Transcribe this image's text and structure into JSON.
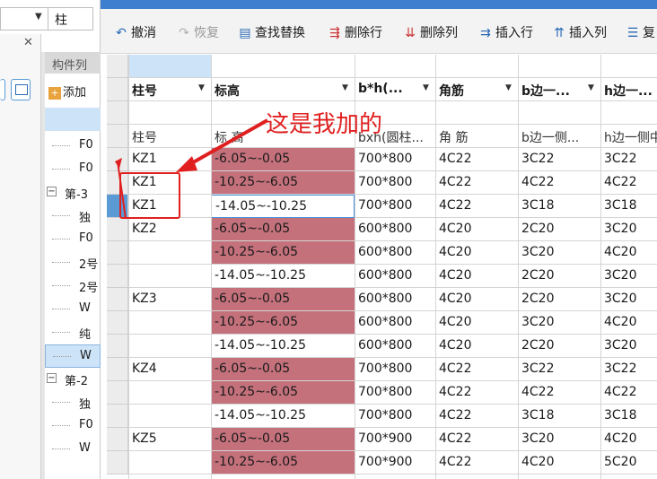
{
  "left_panel": {
    "combo_value": "柱",
    "header": "构件列",
    "add_label": "添加",
    "tree": [
      {
        "type": "item",
        "label": "F0"
      },
      {
        "type": "item",
        "label": "F0"
      },
      {
        "type": "group",
        "label": "第-3"
      },
      {
        "type": "item",
        "label": "独"
      },
      {
        "type": "item",
        "label": "F0"
      },
      {
        "type": "item",
        "label": "2号"
      },
      {
        "type": "item",
        "label": "2号"
      },
      {
        "type": "item",
        "label": "W"
      },
      {
        "type": "item",
        "label": "纯"
      },
      {
        "type": "item",
        "label": "W",
        "selected": true
      },
      {
        "type": "group",
        "label": "第-2"
      },
      {
        "type": "item",
        "label": "独"
      },
      {
        "type": "item",
        "label": "F0"
      },
      {
        "type": "item",
        "label": "W"
      }
    ]
  },
  "toolbar": {
    "undo": "撤消",
    "redo": "恢复",
    "find_replace": "查找替换",
    "delete_row": "删除行",
    "delete_col": "删除列",
    "insert_row": "插入行",
    "insert_col": "插入列",
    "more": "复"
  },
  "table": {
    "headers": [
      "柱号",
      "标高",
      "b*h(...",
      "角筋",
      "b边一...",
      "h边一..."
    ],
    "subheaders": [
      "柱号",
      "标 高",
      "bxh(圆柱...",
      "角 筋",
      "b边一侧...",
      "h边一侧中"
    ],
    "rows": [
      {
        "id": "KZ1",
        "elev": "-6.05~-0.05",
        "bh": "700*800",
        "corner": "4C22",
        "b": "3C22",
        "h": "3C22",
        "pink": true
      },
      {
        "id": "KZ1",
        "elev": "-10.25~-6.05",
        "bh": "700*800",
        "corner": "4C22",
        "b": "4C22",
        "h": "4C22",
        "pink": true
      },
      {
        "id": "KZ1",
        "elev": "-14.05~-10.25",
        "bh": "700*800",
        "corner": "4C22",
        "b": "3C18",
        "h": "3C18",
        "pink": false
      },
      {
        "id": "KZ2",
        "elev": "-6.05~-0.05",
        "bh": "600*800",
        "corner": "4C20",
        "b": "2C20",
        "h": "3C20",
        "pink": true
      },
      {
        "id": "",
        "elev": "-10.25~-6.05",
        "bh": "600*800",
        "corner": "4C20",
        "b": "3C20",
        "h": "4C20",
        "pink": true
      },
      {
        "id": "",
        "elev": "-14.05~-10.25",
        "bh": "600*800",
        "corner": "4C20",
        "b": "2C20",
        "h": "3C20",
        "pink": false
      },
      {
        "id": "KZ3",
        "elev": "-6.05~-0.05",
        "bh": "600*800",
        "corner": "4C20",
        "b": "2C20",
        "h": "3C20",
        "pink": true
      },
      {
        "id": "",
        "elev": "-10.25~-6.05",
        "bh": "600*800",
        "corner": "4C20",
        "b": "3C20",
        "h": "4C20",
        "pink": true
      },
      {
        "id": "",
        "elev": "-14.05~-10.25",
        "bh": "600*800",
        "corner": "4C20",
        "b": "2C20",
        "h": "3C20",
        "pink": false
      },
      {
        "id": "KZ4",
        "elev": "-6.05~-0.05",
        "bh": "700*800",
        "corner": "4C22",
        "b": "3C22",
        "h": "3C22",
        "pink": true
      },
      {
        "id": "",
        "elev": "-10.25~-6.05",
        "bh": "700*800",
        "corner": "4C22",
        "b": "4C22",
        "h": "4C22",
        "pink": true
      },
      {
        "id": "",
        "elev": "-14.05~-10.25",
        "bh": "700*800",
        "corner": "4C22",
        "b": "3C18",
        "h": "3C18",
        "pink": false
      },
      {
        "id": "KZ5",
        "elev": "-6.05~-0.05",
        "bh": "700*900",
        "corner": "4C22",
        "b": "3C20",
        "h": "4C20",
        "pink": true
      },
      {
        "id": "",
        "elev": "-10.25~-6.05",
        "bh": "700*900",
        "corner": "4C22",
        "b": "4C20",
        "h": "5C20",
        "pink": true
      }
    ]
  },
  "annotation": {
    "text": "这是我加的",
    "color": "#e02020"
  },
  "colors": {
    "pink_cell": "#c4717c",
    "selection_blue": "#cde3f8",
    "titlebar": "#3f7fd0"
  }
}
